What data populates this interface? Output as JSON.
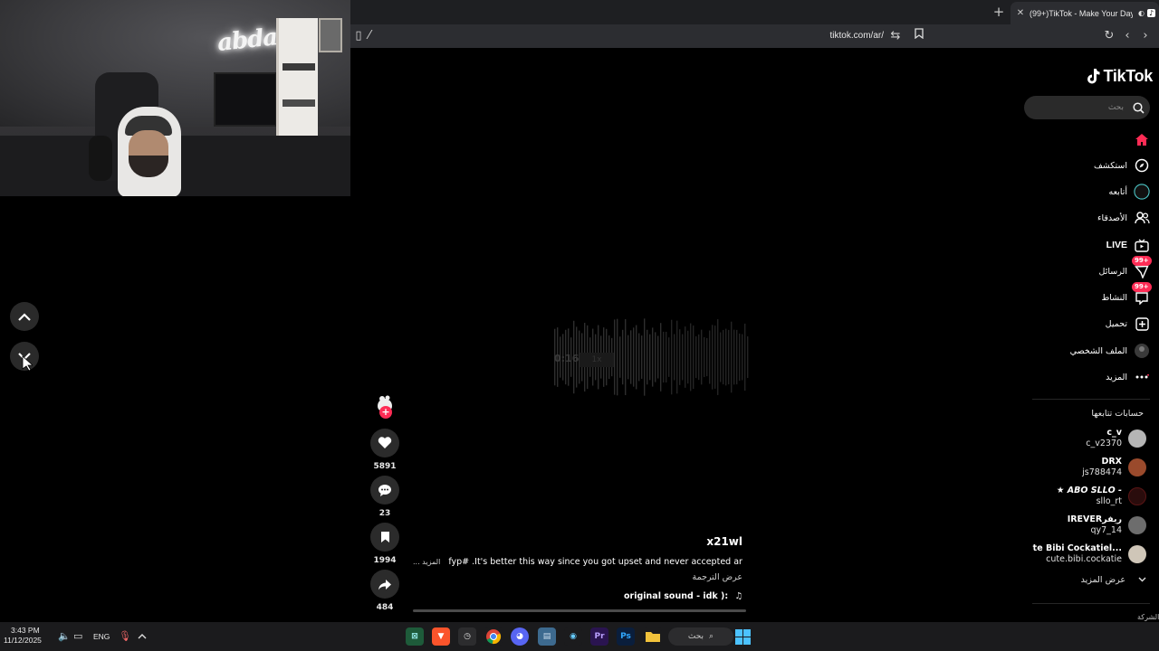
{
  "browser": {
    "tab_title": "(99+)TikTok - Make Your Day",
    "url": "tiktok.com/ar/"
  },
  "tiktok": {
    "logo_text": "TikTok",
    "search_placeholder": "بحث",
    "nav": [
      {
        "label": "",
        "icon": "home-icon",
        "active": true
      },
      {
        "label": "استكشف",
        "icon": "compass-icon"
      },
      {
        "label": "أتابعه",
        "icon": "following-avatar-icon"
      },
      {
        "label": "الأصدقاء",
        "icon": "friends-icon"
      },
      {
        "label": "LIVE",
        "icon": "live-icon"
      },
      {
        "label": "الرسائل",
        "icon": "messages-icon",
        "badge": "99+"
      },
      {
        "label": "النشاط",
        "icon": "activity-icon",
        "badge": "99+"
      },
      {
        "label": "تحميل",
        "icon": "upload-icon"
      },
      {
        "label": "الملف الشخصي",
        "icon": "profile-icon"
      },
      {
        "label": "المزيد",
        "icon": "more-icon"
      }
    ],
    "following_title": "حسابات تتابعها",
    "following": [
      {
        "name": "c_v",
        "handle": "c_v2370"
      },
      {
        "name": "DRX",
        "handle": "js788474"
      },
      {
        "name": "★ 𝘼𝘽𝙊 𝙎𝙇𝙇𝙊 -",
        "handle": "sllo_rt"
      },
      {
        "name": "IREVERريفر",
        "handle": "qy7_14"
      },
      {
        "name": "te Bibi Cockatiel...",
        "handle": "cute.bibi.cockatie"
      }
    ],
    "see_more": "عرض المزيد",
    "footer_fragment": "الشركة",
    "video": {
      "timestamp": "0:16",
      "speed": "1x",
      "likes": "5891",
      "comments": "23",
      "saves": "1994",
      "shares": "484",
      "username": "x21wl",
      "caption": "fyp# .It's better this way since you got upset and never accepted anything",
      "caption_more": "... المزيد",
      "translate": "عرض الترجمة",
      "sound": "original sound - idk ):"
    }
  },
  "taskbar": {
    "time": "3:43 PM",
    "date": "11/12/2025",
    "lang": "ENG",
    "search_label": "بحث"
  },
  "colors": {
    "accent": "#fe2c55",
    "background": "#000000",
    "chrome": "#2c2d31"
  }
}
